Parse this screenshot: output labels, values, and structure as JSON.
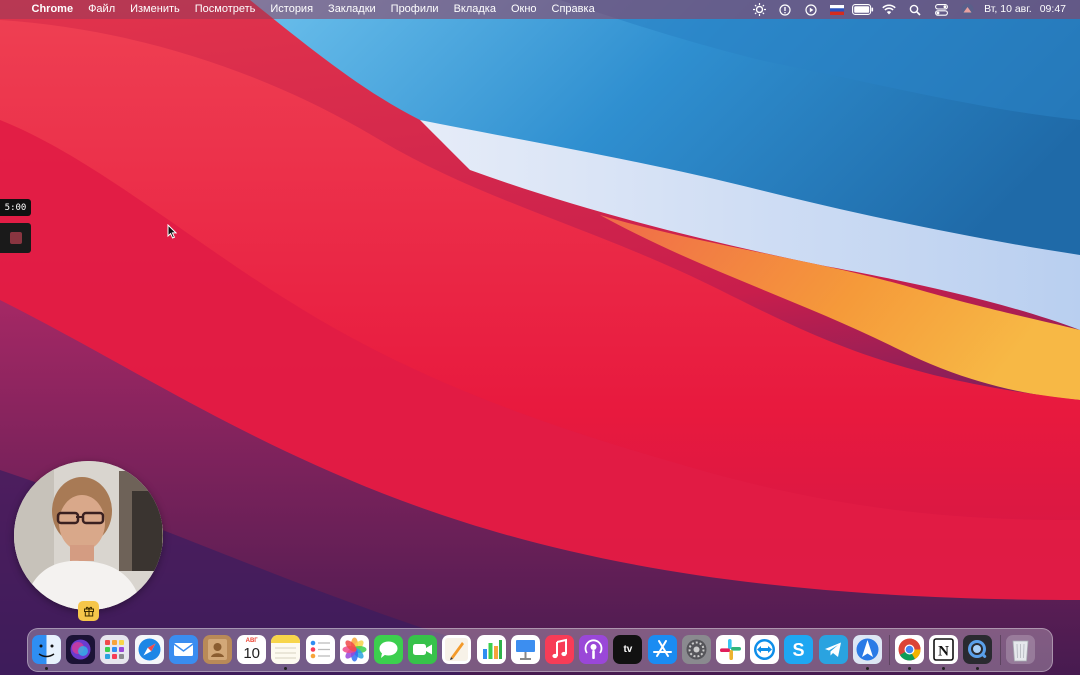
{
  "menubar": {
    "apple_symbol": "",
    "app_name": "Chrome",
    "items": [
      "Файл",
      "Изменить",
      "Посмотреть",
      "История",
      "Закладки",
      "Профили",
      "Вкладка",
      "Окно",
      "Справка"
    ],
    "status_icons": [
      "brightness-icon",
      "info-icon",
      "play-icon",
      "russian-flag-icon",
      "battery-icon",
      "wifi-icon",
      "spotlight-search-icon",
      "control-center-icon",
      "user-avatar-icon"
    ],
    "date": "Вт, 10 авг.",
    "time": "09:47"
  },
  "recorder": {
    "timer": "5:00"
  },
  "webcam": {
    "gift_icon": "gift-icon"
  },
  "dock": {
    "calendar_month": "АВГ",
    "calendar_day": "10",
    "appletv_label": "tv",
    "items": [
      {
        "name": "finder",
        "color": "#2f8ef2",
        "running": true
      },
      {
        "name": "siri",
        "color": "#3b2a7a",
        "running": false
      },
      {
        "name": "launchpad",
        "color": "#e8e8ee",
        "running": false
      },
      {
        "name": "safari",
        "color": "#1d86e6",
        "running": false
      },
      {
        "name": "mail",
        "color": "#3a8df0",
        "running": false
      },
      {
        "name": "contacts",
        "color": "#b98a58",
        "running": false
      },
      {
        "name": "calendar",
        "color": "#ffffff",
        "running": false
      },
      {
        "name": "notes",
        "color": "#f7d54a",
        "running": true
      },
      {
        "name": "reminders",
        "color": "#ffffff",
        "running": false
      },
      {
        "name": "photos",
        "color": "#ffffff",
        "running": false
      },
      {
        "name": "messages",
        "color": "#3ccf4e",
        "running": false
      },
      {
        "name": "facetime",
        "color": "#37c24a",
        "running": false
      },
      {
        "name": "pages",
        "color": "#f39a2a",
        "running": false
      },
      {
        "name": "numbers",
        "color": "#2fb24a",
        "running": false
      },
      {
        "name": "keynote",
        "color": "#3c8ef0",
        "running": false
      },
      {
        "name": "music",
        "color": "#f73c57",
        "running": false
      },
      {
        "name": "podcasts",
        "color": "#9a47d8",
        "running": false
      },
      {
        "name": "apple-tv",
        "color": "#111111",
        "running": false
      },
      {
        "name": "app-store",
        "color": "#1a8cf2",
        "running": false
      },
      {
        "name": "system-preferences",
        "color": "#8a8a8f",
        "running": false
      },
      {
        "name": "slack",
        "color": "#ffffff",
        "running": false
      },
      {
        "name": "teamviewer",
        "color": "#ffffff",
        "running": false
      },
      {
        "name": "skype",
        "color": "#1ea7f2",
        "running": false
      },
      {
        "name": "telegram",
        "color": "#2aa3e0",
        "running": false
      },
      {
        "name": "testflight",
        "color": "#e8eef8",
        "running": true
      },
      {
        "name": "chrome",
        "color": "#ffffff",
        "running": true
      },
      {
        "name": "notion",
        "color": "#ffffff",
        "running": true
      },
      {
        "name": "quicktime",
        "color": "#2a2a30",
        "running": true
      },
      {
        "name": "trash",
        "color": "#e8e8ec",
        "running": false
      }
    ]
  },
  "colors": {
    "accent_red": "#e8213a",
    "sky_blue": "#3fa0db",
    "orange": "#f5a640",
    "deep_purple": "#3a1d60"
  }
}
